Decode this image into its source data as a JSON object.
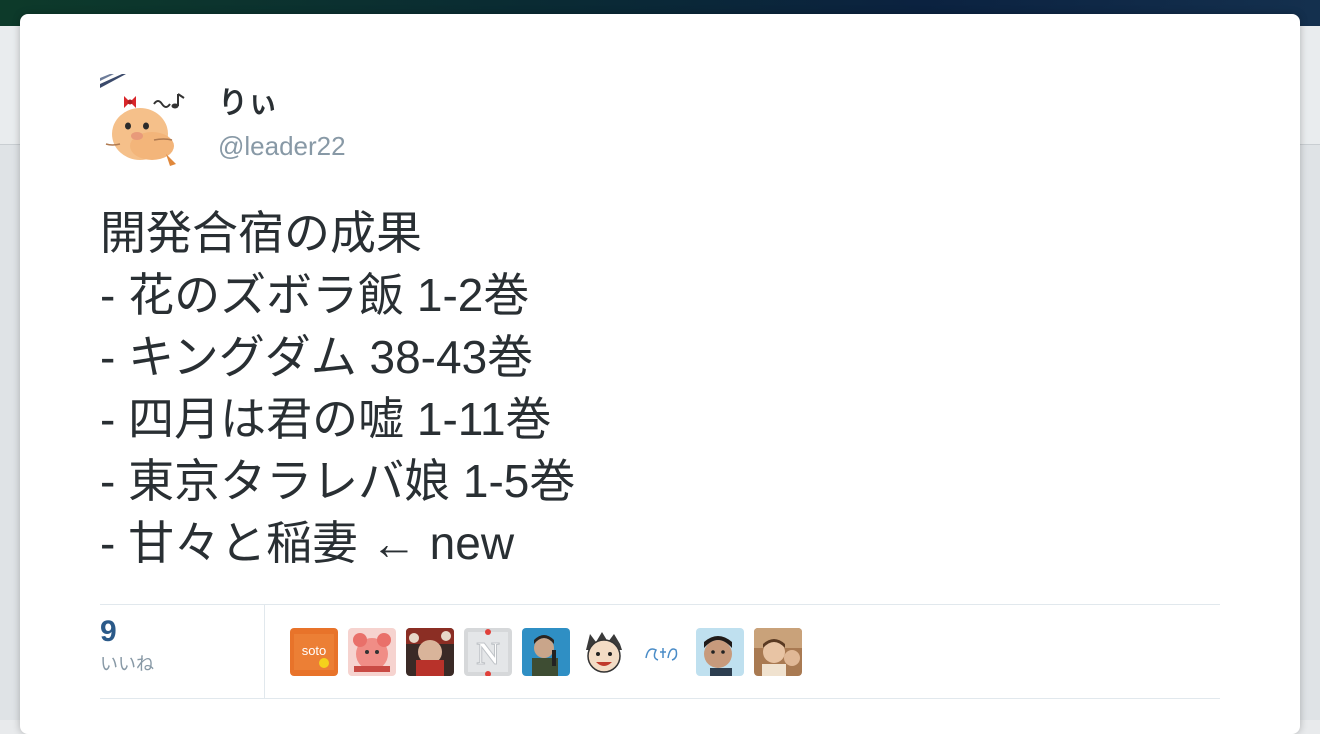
{
  "user": {
    "display_name": "りぃ",
    "screen_name": "@leader22"
  },
  "tweet": {
    "lines": [
      "開発合宿の成果",
      "- 花のズボラ飯 1-2巻",
      "- キングダム 38-43巻",
      "- 四月は君の嘘 1-11巻",
      "- 東京タラレバ娘 1-5巻",
      "- 甘々と稲妻 ← new"
    ]
  },
  "stats": {
    "like_count": "9",
    "like_label": "いいね"
  },
  "likers": [
    {
      "icon": "soto-logo-avatar",
      "text": "soto"
    },
    {
      "icon": "pink-character-avatar"
    },
    {
      "icon": "festival-photo-avatar"
    },
    {
      "icon": "letter-n-avatar",
      "text": "N"
    },
    {
      "icon": "person-blue-background-avatar"
    },
    {
      "icon": "cartoon-face-avatar"
    },
    {
      "icon": "handwritten-doodle-avatar"
    },
    {
      "icon": "person-selfie-avatar"
    },
    {
      "icon": "child-photo-avatar"
    }
  ],
  "colors": {
    "text_primary": "#292f33",
    "text_secondary": "#8899a6",
    "like_count_blue": "#2b5a89",
    "divider": "#e1e8ed"
  }
}
